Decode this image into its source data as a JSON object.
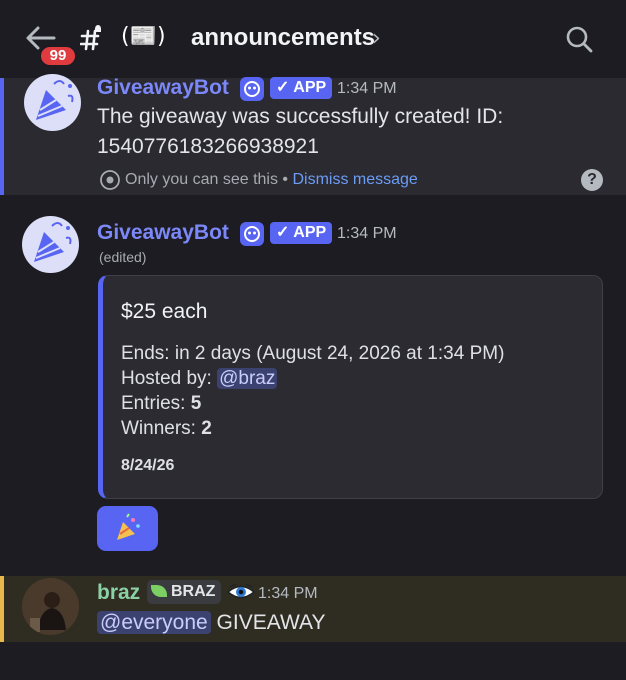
{
  "header": {
    "badge_count": "99",
    "channel_emoji": "(📰)",
    "channel_name": "announcements"
  },
  "ephemeral_message": {
    "author": "GiveawayBot",
    "app_tag": "✓ APP",
    "time": "1:34 PM",
    "line1": "The giveaway was successfully created! ID:",
    "line2": "1540776183266938921",
    "visibility_text": "Only you can see this",
    "separator": " • ",
    "dismiss_text": "Dismiss message"
  },
  "giveaway_message": {
    "author": "GiveawayBot",
    "app_tag": "✓ APP",
    "time": "1:34 PM",
    "edited": "(edited)",
    "embed": {
      "title": "$25 each",
      "ends_label": "Ends: in 2 days (August 24, 2026 at 1:34 PM)",
      "hosted_label": "Hosted by: ",
      "hosted_mention": "@braz",
      "entries_label": "Entries: ",
      "entries_value": "5",
      "winners_label": "Winners: ",
      "winners_value": "2",
      "footer_date": "8/24/26"
    },
    "reaction_emoji": "🎉"
  },
  "user_message": {
    "author": "braz",
    "tag": "BRAZ",
    "time": "1:34 PM",
    "mention": "@everyone",
    "text": " GIVEAWAY"
  },
  "colors": {
    "accent": "#5865f2",
    "bot_name": "#7c88f9",
    "user_name": "#8ad1a3",
    "highlight_border": "#e8b84a"
  }
}
